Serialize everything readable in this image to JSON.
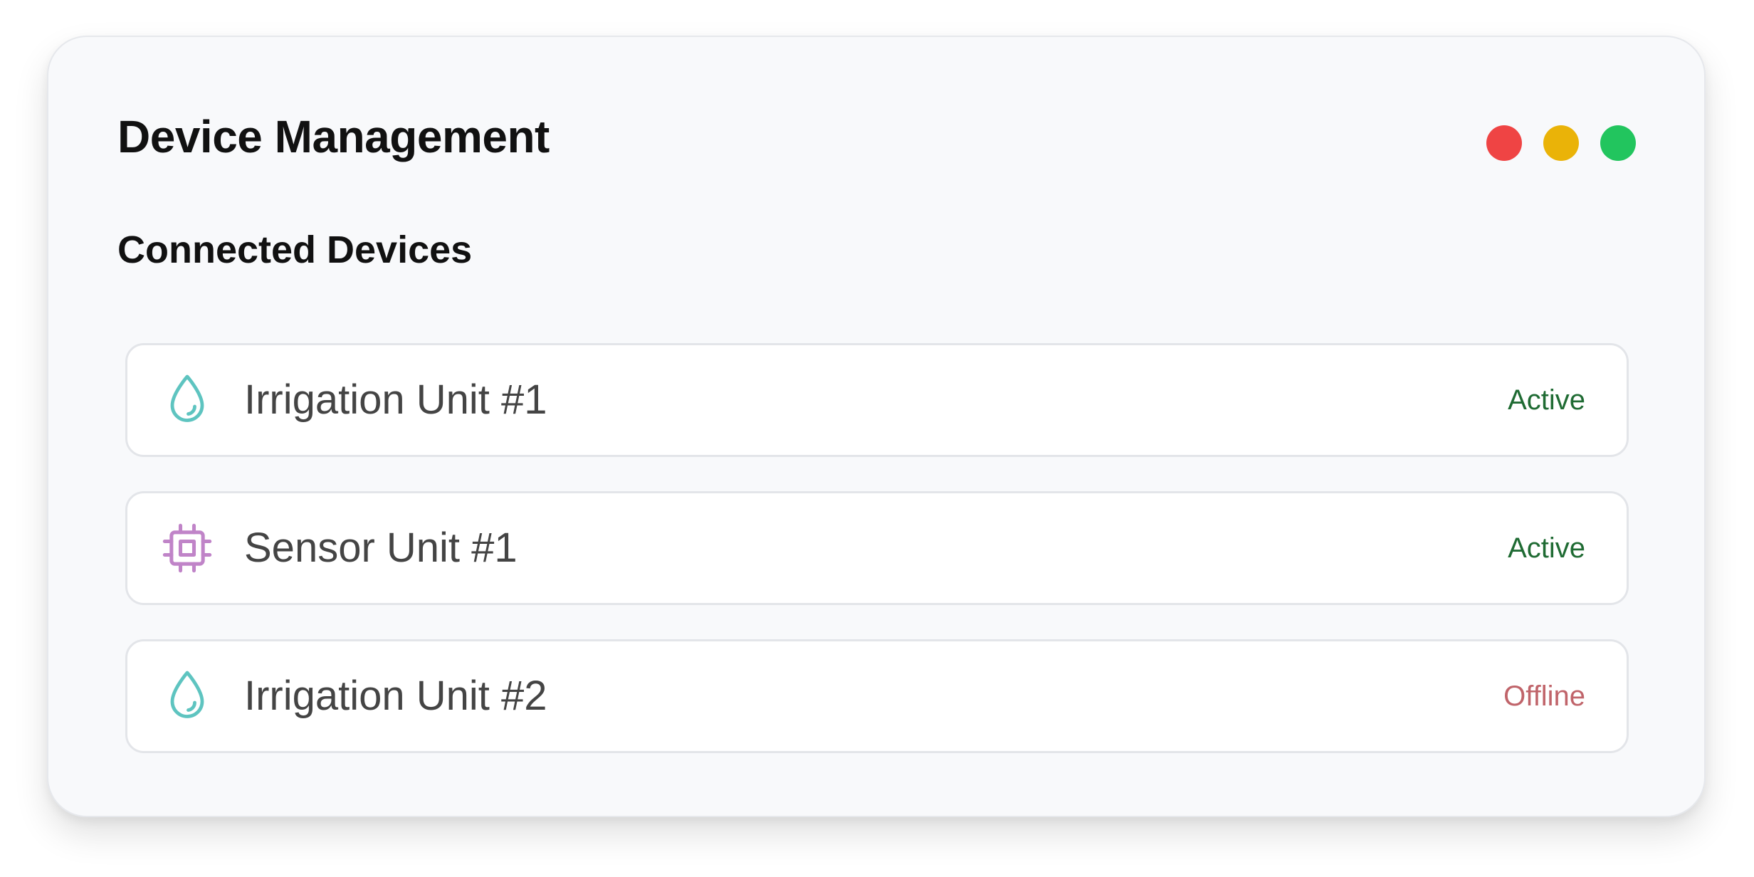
{
  "header": {
    "title": "Device Management"
  },
  "window_controls": [
    {
      "name": "close-dot",
      "color": "#ef4444"
    },
    {
      "name": "minimize-dot",
      "color": "#eab308"
    },
    {
      "name": "maximize-dot",
      "color": "#22c55e"
    }
  ],
  "section": {
    "title": "Connected Devices"
  },
  "devices": [
    {
      "name": "Irrigation Unit #1",
      "status": "Active",
      "icon": "water-drop-icon",
      "icon_color": "#5ec4c0",
      "status_color": "#1f6b33"
    },
    {
      "name": "Sensor Unit #1",
      "status": "Active",
      "icon": "chip-icon",
      "icon_color": "#c084c8",
      "status_color": "#1f6b33"
    },
    {
      "name": "Irrigation Unit #2",
      "status": "Offline",
      "icon": "water-drop-icon",
      "icon_color": "#5ec4c0",
      "status_color": "#c0646a"
    }
  ]
}
